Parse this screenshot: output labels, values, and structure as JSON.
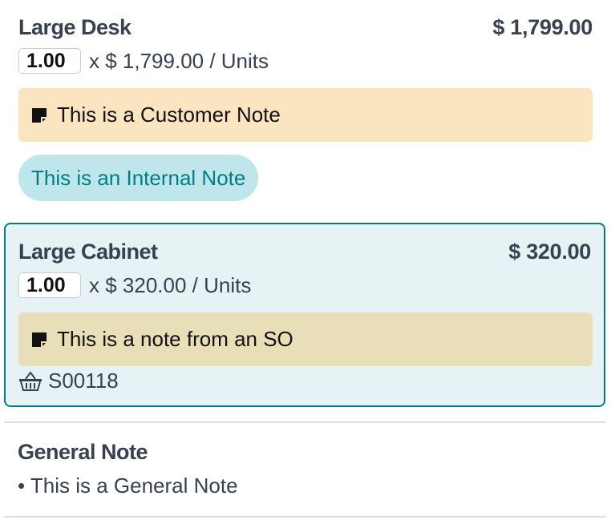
{
  "lines": [
    {
      "product": "Large Desk",
      "price": "$ 1,799.00",
      "qty": "1.00",
      "unit_text": "x $ 1,799.00 / Units",
      "customer_note": "This is a Customer Note",
      "internal_note": "This is an Internal Note"
    },
    {
      "product": "Large Cabinet",
      "price": "$ 320.00",
      "qty": "1.00",
      "unit_text": "x $ 320.00 / Units",
      "customer_note": "This is a note from an SO",
      "origin": "S00118"
    }
  ],
  "general_note": {
    "title": "General Note",
    "text": "• This is a General Note"
  },
  "icons": {
    "note": "sticky-note-icon",
    "origin": "basket-icon"
  },
  "colors": {
    "accent": "#017e84",
    "selected_bg": "#e6f2f3",
    "customer_note_bg": "#fbe5c1",
    "so_note_bg": "#e8dfb8",
    "internal_note_bg": "#bfe6ea"
  }
}
